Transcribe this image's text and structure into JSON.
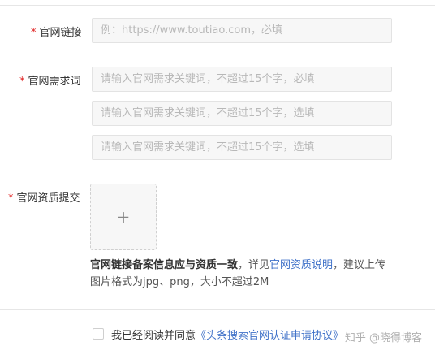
{
  "form": {
    "website_link": {
      "required_mark": "*",
      "label": "官网链接",
      "placeholder": "例：https://www.toutiao.com，必填"
    },
    "website_keywords": {
      "required_mark": "*",
      "label": "官网需求词",
      "placeholders": [
        "请输入官网需求关键词，不超过15个字，必填",
        "请输入官网需求关键词，不超过15个字，选填",
        "请输入官网需求关键词，不超过15个字，选填"
      ]
    },
    "qualification": {
      "required_mark": "*",
      "label": "官网资质提交",
      "upload_icon": "plus-icon",
      "hint_strong": "官网链接备案信息应与资质一致",
      "hint_mid": "，详见",
      "hint_link": "官网资质说明",
      "hint_tail": "，建议上传图片格式为jpg、png，大小不超过2M"
    }
  },
  "agreement": {
    "text": "我已经阅读并同意",
    "link": "《头条搜索官网认证申请协议》"
  },
  "watermark": "知乎 @晓得博客",
  "colors": {
    "required": "#e02020",
    "link": "#3f71c8",
    "input_bg": "#f7f7f7"
  }
}
